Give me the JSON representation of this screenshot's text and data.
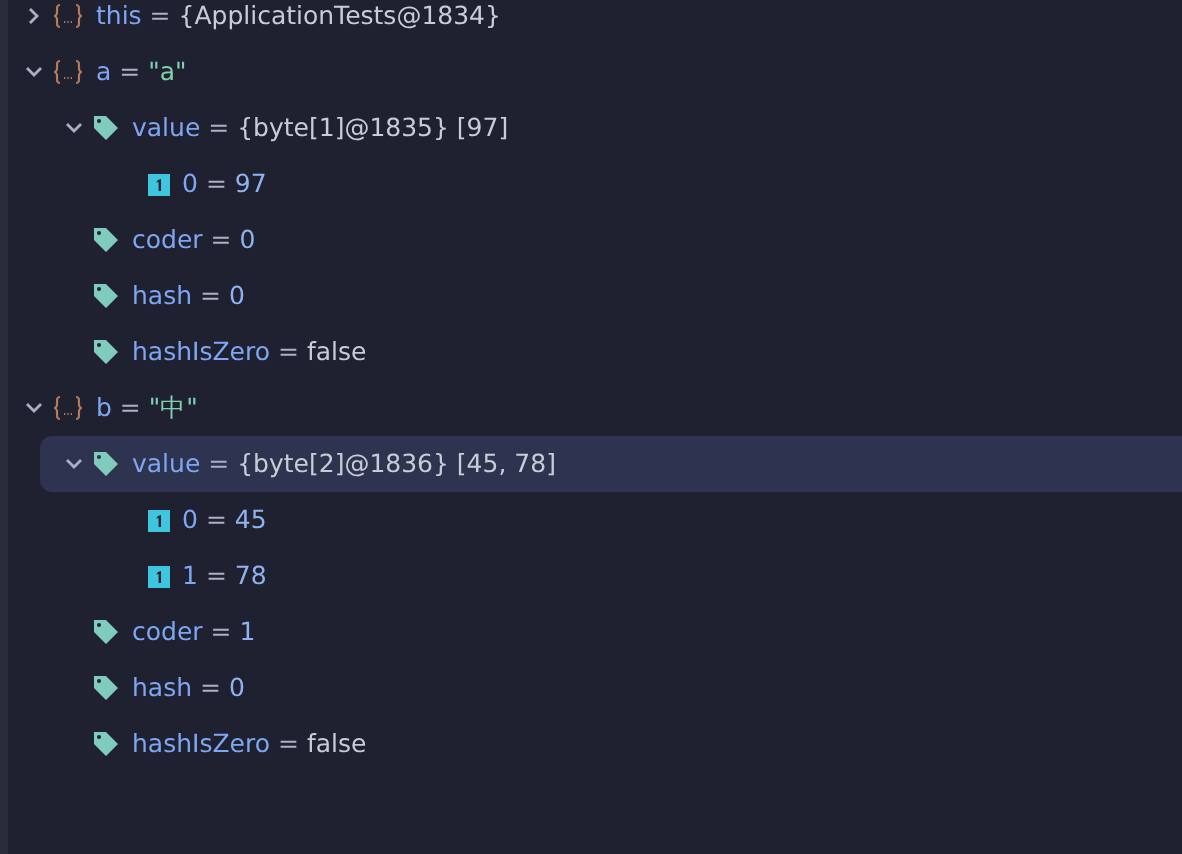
{
  "variables": [
    {
      "kind": "object",
      "name": "this",
      "operator": "=",
      "value": "{ApplicationTests@1834}",
      "color": "#c8cbd8",
      "expanded": false,
      "selected": false
    },
    {
      "kind": "object",
      "name": "a",
      "operator": "=",
      "value": "\"a\"",
      "color": "#7fd1b0",
      "expanded": true,
      "selected": false,
      "children": [
        {
          "kind": "field",
          "name": "value",
          "operator": "=",
          "value": "{byte[1]@1835} [97]",
          "color": "#c8cbd8",
          "expanded": true,
          "selected": false,
          "children": [
            {
              "kind": "item",
              "name": "0",
              "operator": "=",
              "value": "97",
              "color": "#8fb3f0",
              "selected": false
            }
          ]
        },
        {
          "kind": "field",
          "name": "coder",
          "operator": "=",
          "value": "0",
          "color": "#8fb3f0",
          "selected": false
        },
        {
          "kind": "field",
          "name": "hash",
          "operator": "=",
          "value": "0",
          "color": "#8fb3f0",
          "selected": false
        },
        {
          "kind": "field",
          "name": "hashIsZero",
          "operator": "=",
          "value": "false",
          "color": "#c8cbd8",
          "selected": false
        }
      ]
    },
    {
      "kind": "object",
      "name": "b",
      "operator": "=",
      "value": "\"中\"",
      "color": "#7fd1b0",
      "expanded": true,
      "selected": false,
      "children": [
        {
          "kind": "field",
          "name": "value",
          "operator": "=",
          "value": "{byte[2]@1836} [45, 78]",
          "color": "#c8cbd8",
          "expanded": true,
          "selected": true,
          "children": [
            {
              "kind": "item",
              "name": "0",
              "operator": "=",
              "value": "45",
              "color": "#8fb3f0",
              "selected": false
            },
            {
              "kind": "item",
              "name": "1",
              "operator": "=",
              "value": "78",
              "color": "#8fb3f0",
              "selected": false
            }
          ]
        },
        {
          "kind": "field",
          "name": "coder",
          "operator": "=",
          "value": "1",
          "color": "#8fb3f0",
          "selected": false
        },
        {
          "kind": "field",
          "name": "hash",
          "operator": "=",
          "value": "0",
          "color": "#8fb3f0",
          "selected": false
        },
        {
          "kind": "field",
          "name": "hashIsZero",
          "operator": "=",
          "value": "false",
          "color": "#c8cbd8",
          "selected": false
        }
      ]
    }
  ]
}
